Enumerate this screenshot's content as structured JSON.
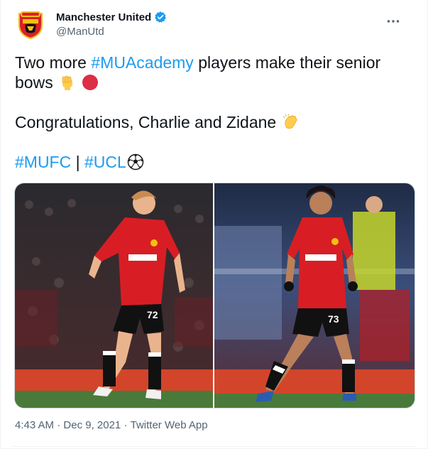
{
  "account": {
    "display_name": "Manchester United",
    "handle": "@ManUtd",
    "verified": true,
    "avatar_icon": "man-utd-crest-icon"
  },
  "tweet": {
    "line1_plain": "Two more ",
    "line1_hashtag": "#MUAcademy",
    "line1_rest": " players make their senior",
    "line2": "bows",
    "line2_emojis": [
      "raised-fist-emoji",
      "red-circle-emoji"
    ],
    "line3": "Congratulations, Charlie and Zidane",
    "line3_emoji": "clapping-hands-emoji",
    "hashtag1": "#MUFC",
    "separator": " | ",
    "hashtag2": "#UCL",
    "hashtag2_emoji": "soccer-ball-emoji"
  },
  "meta": {
    "time": "4:43 AM",
    "dot1": " · ",
    "date": "Dec 9, 2021",
    "dot2": " · ",
    "source": "Twitter Web App"
  },
  "photos": [
    {
      "number": "72",
      "sponsor": "TeamViewer"
    },
    {
      "number": "73",
      "sponsor": "TeamViewer"
    }
  ],
  "colors": {
    "hashtag": "#1d9bf0",
    "secondary_text": "#536471",
    "kit_red": "#d81e24",
    "pitch_green": "#4a7a3a"
  }
}
